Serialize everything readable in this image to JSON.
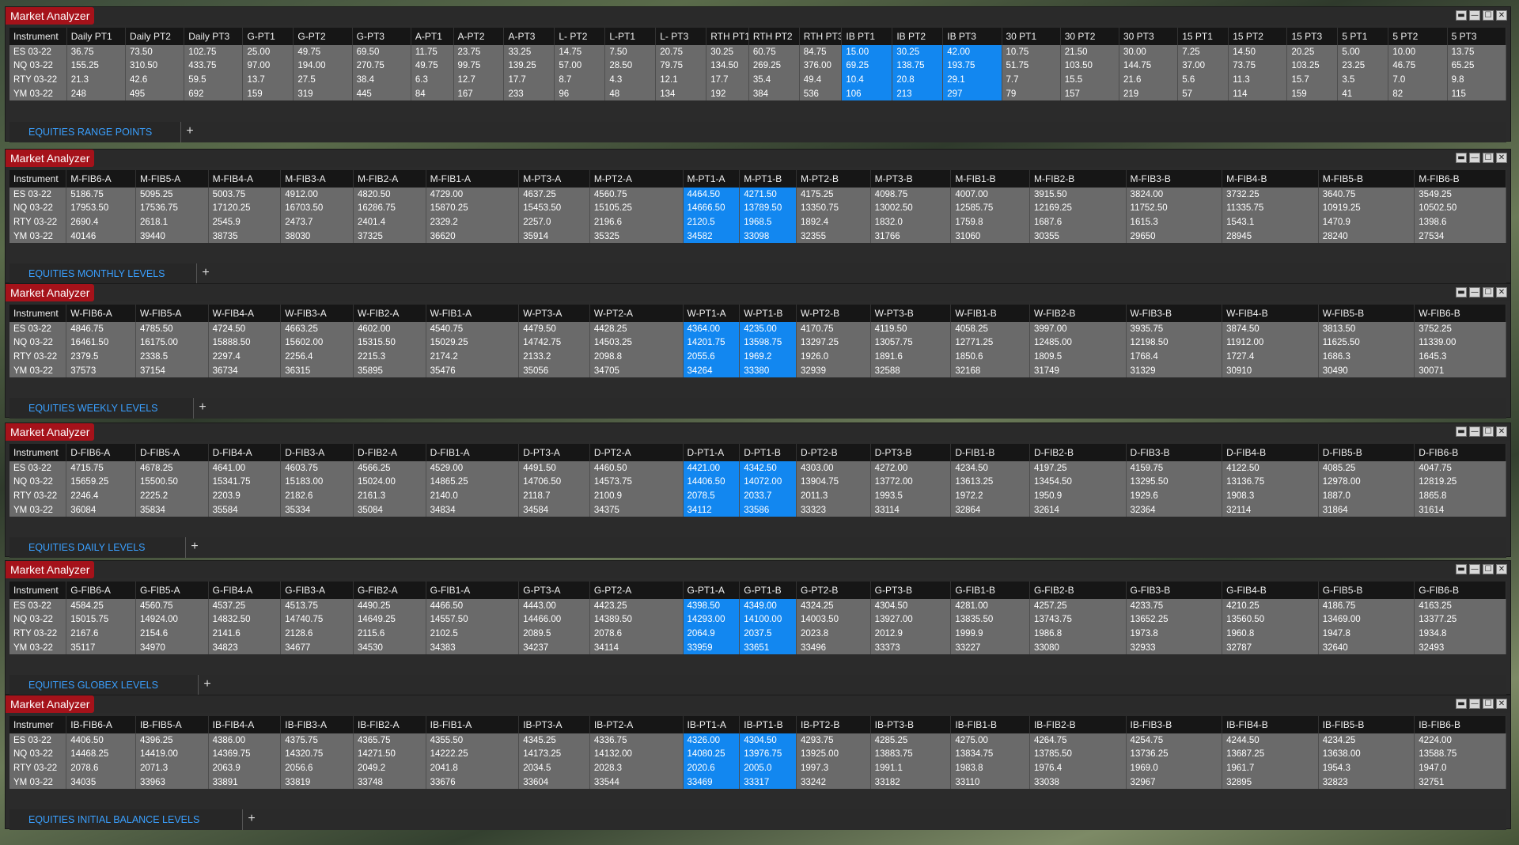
{
  "window_title": "Market Analyzer",
  "win_buttons": [
    "▬",
    "—",
    "☐",
    "✕"
  ],
  "add_tab": "+",
  "panels": [
    {
      "tab": "EQUITIES RANGE POINTS",
      "headers": [
        "Instrument",
        "Daily PT1",
        "Daily PT2",
        "Daily PT3",
        "G-PT1",
        "G-PT2",
        "G-PT3",
        "A-PT1",
        "A-PT2",
        "A-PT3",
        "L- PT2",
        "L-PT1",
        "L- PT3",
        "RTH PT1",
        "RTH PT2",
        "RTH PT3",
        "IB PT1",
        "IB PT2",
        "IB PT3",
        "30 PT1",
        "30 PT2",
        "30 PT3",
        "15 PT1",
        "15 PT2",
        "15 PT3",
        "5 PT1",
        "5 PT2",
        "5 PT3"
      ],
      "highlight": [
        16,
        17,
        18
      ],
      "rows": [
        [
          "ES 03-22",
          "36.75",
          "73.50",
          "102.75",
          "25.00",
          "49.75",
          "69.50",
          "11.75",
          "23.75",
          "33.25",
          "14.75",
          "7.50",
          "20.75",
          "30.25",
          "60.75",
          "84.75",
          "15.00",
          "30.25",
          "42.00",
          "10.75",
          "21.50",
          "30.00",
          "7.25",
          "14.50",
          "20.25",
          "5.00",
          "10.00",
          "13.75"
        ],
        [
          "NQ 03-22",
          "155.25",
          "310.50",
          "433.75",
          "97.00",
          "194.00",
          "270.75",
          "49.75",
          "99.75",
          "139.25",
          "57.00",
          "28.50",
          "79.75",
          "134.50",
          "269.25",
          "376.00",
          "69.25",
          "138.75",
          "193.75",
          "51.75",
          "103.50",
          "144.75",
          "37.00",
          "73.75",
          "103.25",
          "23.25",
          "46.75",
          "65.25"
        ],
        [
          "RTY 03-22",
          "21.3",
          "42.6",
          "59.5",
          "13.7",
          "27.5",
          "38.4",
          "6.3",
          "12.7",
          "17.7",
          "8.7",
          "4.3",
          "12.1",
          "17.7",
          "35.4",
          "49.4",
          "10.4",
          "20.8",
          "29.1",
          "7.7",
          "15.5",
          "21.6",
          "5.6",
          "11.3",
          "15.7",
          "3.5",
          "7.0",
          "9.8"
        ],
        [
          "YM 03-22",
          "248",
          "495",
          "692",
          "159",
          "319",
          "445",
          "84",
          "167",
          "233",
          "96",
          "48",
          "134",
          "192",
          "384",
          "536",
          "106",
          "213",
          "297",
          "79",
          "157",
          "219",
          "57",
          "114",
          "159",
          "41",
          "82",
          "115"
        ]
      ]
    },
    {
      "tab": "EQUITIES MONTHLY LEVELS",
      "headers": [
        "Instrument",
        "M-FIB6-A",
        "M-FIB5-A",
        "M-FIB4-A",
        "M-FIB3-A",
        "M-FIB2-A",
        "M-FIB1-A",
        "M-PT3-A",
        "M-PT2-A",
        "M-PT1-A",
        "M-PT1-B",
        "M-PT2-B",
        "M-PT3-B",
        "M-FIB1-B",
        "M-FIB2-B",
        "M-FIB3-B",
        "M-FIB4-B",
        "M-FIB5-B",
        "M-FIB6-B"
      ],
      "highlight": [
        9,
        10
      ],
      "rows": [
        [
          "ES 03-22",
          "5186.75",
          "5095.25",
          "5003.75",
          "4912.00",
          "4820.50",
          "4729.00",
          "4637.25",
          "4560.75",
          "4464.50",
          "4271.50",
          "4175.25",
          "4098.75",
          "4007.00",
          "3915.50",
          "3824.00",
          "3732.25",
          "3640.75",
          "3549.25"
        ],
        [
          "NQ 03-22",
          "17953.50",
          "17536.75",
          "17120.25",
          "16703.50",
          "16286.75",
          "15870.25",
          "15453.50",
          "15105.25",
          "14666.50",
          "13789.50",
          "13350.75",
          "13002.50",
          "12585.75",
          "12169.25",
          "11752.50",
          "11335.75",
          "10919.25",
          "10502.50"
        ],
        [
          "RTY 03-22",
          "2690.4",
          "2618.1",
          "2545.9",
          "2473.7",
          "2401.4",
          "2329.2",
          "2257.0",
          "2196.6",
          "2120.5",
          "1968.5",
          "1892.4",
          "1832.0",
          "1759.8",
          "1687.6",
          "1615.3",
          "1543.1",
          "1470.9",
          "1398.6"
        ],
        [
          "YM 03-22",
          "40146",
          "39440",
          "38735",
          "38030",
          "37325",
          "36620",
          "35914",
          "35325",
          "34582",
          "33098",
          "32355",
          "31766",
          "31060",
          "30355",
          "29650",
          "28945",
          "28240",
          "27534"
        ]
      ]
    },
    {
      "tab": "EQUITIES WEEKLY LEVELS",
      "headers": [
        "Instrument",
        "W-FIB6-A",
        "W-FIB5-A",
        "W-FIB4-A",
        "W-FIB3-A",
        "W-FIB2-A",
        "W-FIB1-A",
        "W-PT3-A",
        "W-PT2-A",
        "W-PT1-A",
        "W-PT1-B",
        "W-PT2-B",
        "W-PT3-B",
        "W-FIB1-B",
        "W-FIB2-B",
        "W-FIB3-B",
        "W-FIB4-B",
        "W-FIB5-B",
        "W-FIB6-B"
      ],
      "highlight": [
        9,
        10
      ],
      "rows": [
        [
          "ES 03-22",
          "4846.75",
          "4785.50",
          "4724.50",
          "4663.25",
          "4602.00",
          "4540.75",
          "4479.50",
          "4428.25",
          "4364.00",
          "4235.00",
          "4170.75",
          "4119.50",
          "4058.25",
          "3997.00",
          "3935.75",
          "3874.50",
          "3813.50",
          "3752.25"
        ],
        [
          "NQ 03-22",
          "16461.50",
          "16175.00",
          "15888.50",
          "15602.00",
          "15315.50",
          "15029.25",
          "14742.75",
          "14503.25",
          "14201.75",
          "13598.75",
          "13297.25",
          "13057.75",
          "12771.25",
          "12485.00",
          "12198.50",
          "11912.00",
          "11625.50",
          "11339.00"
        ],
        [
          "RTY 03-22",
          "2379.5",
          "2338.5",
          "2297.4",
          "2256.4",
          "2215.3",
          "2174.2",
          "2133.2",
          "2098.8",
          "2055.6",
          "1969.2",
          "1926.0",
          "1891.6",
          "1850.6",
          "1809.5",
          "1768.4",
          "1727.4",
          "1686.3",
          "1645.3"
        ],
        [
          "YM 03-22",
          "37573",
          "37154",
          "36734",
          "36315",
          "35895",
          "35476",
          "35056",
          "34705",
          "34264",
          "33380",
          "32939",
          "32588",
          "32168",
          "31749",
          "31329",
          "30910",
          "30490",
          "30071"
        ]
      ]
    },
    {
      "tab": "EQUITIES DAILY LEVELS",
      "headers": [
        "Instrument",
        "D-FIB6-A",
        "D-FIB5-A",
        "D-FIB4-A",
        "D-FIB3-A",
        "D-FIB2-A",
        "D-FIB1-A",
        "D-PT3-A",
        "D-PT2-A",
        "D-PT1-A",
        "D-PT1-B",
        "D-PT2-B",
        "D-PT3-B",
        "D-FIB1-B",
        "D-FIB2-B",
        "D-FIB3-B",
        "D-FIB4-B",
        "D-FIB5-B",
        "D-FIB6-B"
      ],
      "highlight": [
        9,
        10
      ],
      "rows": [
        [
          "ES 03-22",
          "4715.75",
          "4678.25",
          "4641.00",
          "4603.75",
          "4566.25",
          "4529.00",
          "4491.50",
          "4460.50",
          "4421.00",
          "4342.50",
          "4303.00",
          "4272.00",
          "4234.50",
          "4197.25",
          "4159.75",
          "4122.50",
          "4085.25",
          "4047.75"
        ],
        [
          "NQ 03-22",
          "15659.25",
          "15500.50",
          "15341.75",
          "15183.00",
          "15024.00",
          "14865.25",
          "14706.50",
          "14573.75",
          "14406.50",
          "14072.00",
          "13904.75",
          "13772.00",
          "13613.25",
          "13454.50",
          "13295.50",
          "13136.75",
          "12978.00",
          "12819.25"
        ],
        [
          "RTY 03-22",
          "2246.4",
          "2225.2",
          "2203.9",
          "2182.6",
          "2161.3",
          "2140.0",
          "2118.7",
          "2100.9",
          "2078.5",
          "2033.7",
          "2011.3",
          "1993.5",
          "1972.2",
          "1950.9",
          "1929.6",
          "1908.3",
          "1887.0",
          "1865.8"
        ],
        [
          "YM 03-22",
          "36084",
          "35834",
          "35584",
          "35334",
          "35084",
          "34834",
          "34584",
          "34375",
          "34112",
          "33586",
          "33323",
          "33114",
          "32864",
          "32614",
          "32364",
          "32114",
          "31864",
          "31614"
        ]
      ]
    },
    {
      "tab": "EQUITIES GLOBEX LEVELS",
      "headers": [
        "Instrument",
        "G-FIB6-A",
        "G-FIB5-A",
        "G-FIB4-A",
        "G-FIB3-A",
        "G-FIB2-A",
        "G-FIB1-A",
        "G-PT3-A",
        "G-PT2-A",
        "G-PT1-A",
        "G-PT1-B",
        "G-PT2-B",
        "G-PT3-B",
        "G-FIB1-B",
        "G-FIB2-B",
        "G-FIB3-B",
        "G-FIB4-B",
        "G-FIB5-B",
        "G-FIB6-B"
      ],
      "highlight": [
        9,
        10
      ],
      "rows": [
        [
          "ES 03-22",
          "4584.25",
          "4560.75",
          "4537.25",
          "4513.75",
          "4490.25",
          "4466.50",
          "4443.00",
          "4423.25",
          "4398.50",
          "4349.00",
          "4324.25",
          "4304.50",
          "4281.00",
          "4257.25",
          "4233.75",
          "4210.25",
          "4186.75",
          "4163.25"
        ],
        [
          "NQ 03-22",
          "15015.75",
          "14924.00",
          "14832.50",
          "14740.75",
          "14649.25",
          "14557.50",
          "14466.00",
          "14389.50",
          "14293.00",
          "14100.00",
          "14003.50",
          "13927.00",
          "13835.50",
          "13743.75",
          "13652.25",
          "13560.50",
          "13469.00",
          "13377.25"
        ],
        [
          "RTY 03-22",
          "2167.6",
          "2154.6",
          "2141.6",
          "2128.6",
          "2115.6",
          "2102.5",
          "2089.5",
          "2078.6",
          "2064.9",
          "2037.5",
          "2023.8",
          "2012.9",
          "1999.9",
          "1986.8",
          "1973.8",
          "1960.8",
          "1947.8",
          "1934.8"
        ],
        [
          "YM 03-22",
          "35117",
          "34970",
          "34823",
          "34677",
          "34530",
          "34383",
          "34237",
          "34114",
          "33959",
          "33651",
          "33496",
          "33373",
          "33227",
          "33080",
          "32933",
          "32787",
          "32640",
          "32493"
        ]
      ]
    },
    {
      "tab": "EQUITIES INITIAL BALANCE LEVELS",
      "headers": [
        "Instrumer",
        "IB-FIB6-A",
        "IB-FIB5-A",
        "IB-FIB4-A",
        "IB-FIB3-A",
        "IB-FIB2-A",
        "IB-FIB1-A",
        "IB-PT3-A",
        "IB-PT2-A",
        "IB-PT1-A",
        "IB-PT1-B",
        "IB-PT2-B",
        "IB-PT3-B",
        "IB-FIB1-B",
        "IB-FIB2-B",
        "IB-FIB3-B",
        "IB-FIB4-B",
        "IB-FIB5-B",
        "IB-FIB6-B"
      ],
      "highlight": [
        9,
        10
      ],
      "rows": [
        [
          "ES 03-22",
          "4406.50",
          "4396.25",
          "4386.00",
          "4375.75",
          "4365.75",
          "4355.50",
          "4345.25",
          "4336.75",
          "4326.00",
          "4304.50",
          "4293.75",
          "4285.25",
          "4275.00",
          "4264.75",
          "4254.75",
          "4244.50",
          "4234.25",
          "4224.00"
        ],
        [
          "NQ 03-22",
          "14468.25",
          "14419.00",
          "14369.75",
          "14320.75",
          "14271.50",
          "14222.25",
          "14173.25",
          "14132.00",
          "14080.25",
          "13976.75",
          "13925.00",
          "13883.75",
          "13834.75",
          "13785.50",
          "13736.25",
          "13687.25",
          "13638.00",
          "13588.75"
        ],
        [
          "RTY 03-22",
          "2078.6",
          "2071.3",
          "2063.9",
          "2056.6",
          "2049.2",
          "2041.8",
          "2034.5",
          "2028.3",
          "2020.6",
          "2005.0",
          "1997.3",
          "1991.1",
          "1983.8",
          "1976.4",
          "1969.0",
          "1961.7",
          "1954.3",
          "1947.0"
        ],
        [
          "YM 03-22",
          "34035",
          "33963",
          "33891",
          "33819",
          "33748",
          "33676",
          "33604",
          "33544",
          "33469",
          "33317",
          "33242",
          "33182",
          "33110",
          "33038",
          "32967",
          "32895",
          "32823",
          "32751"
        ]
      ]
    }
  ]
}
